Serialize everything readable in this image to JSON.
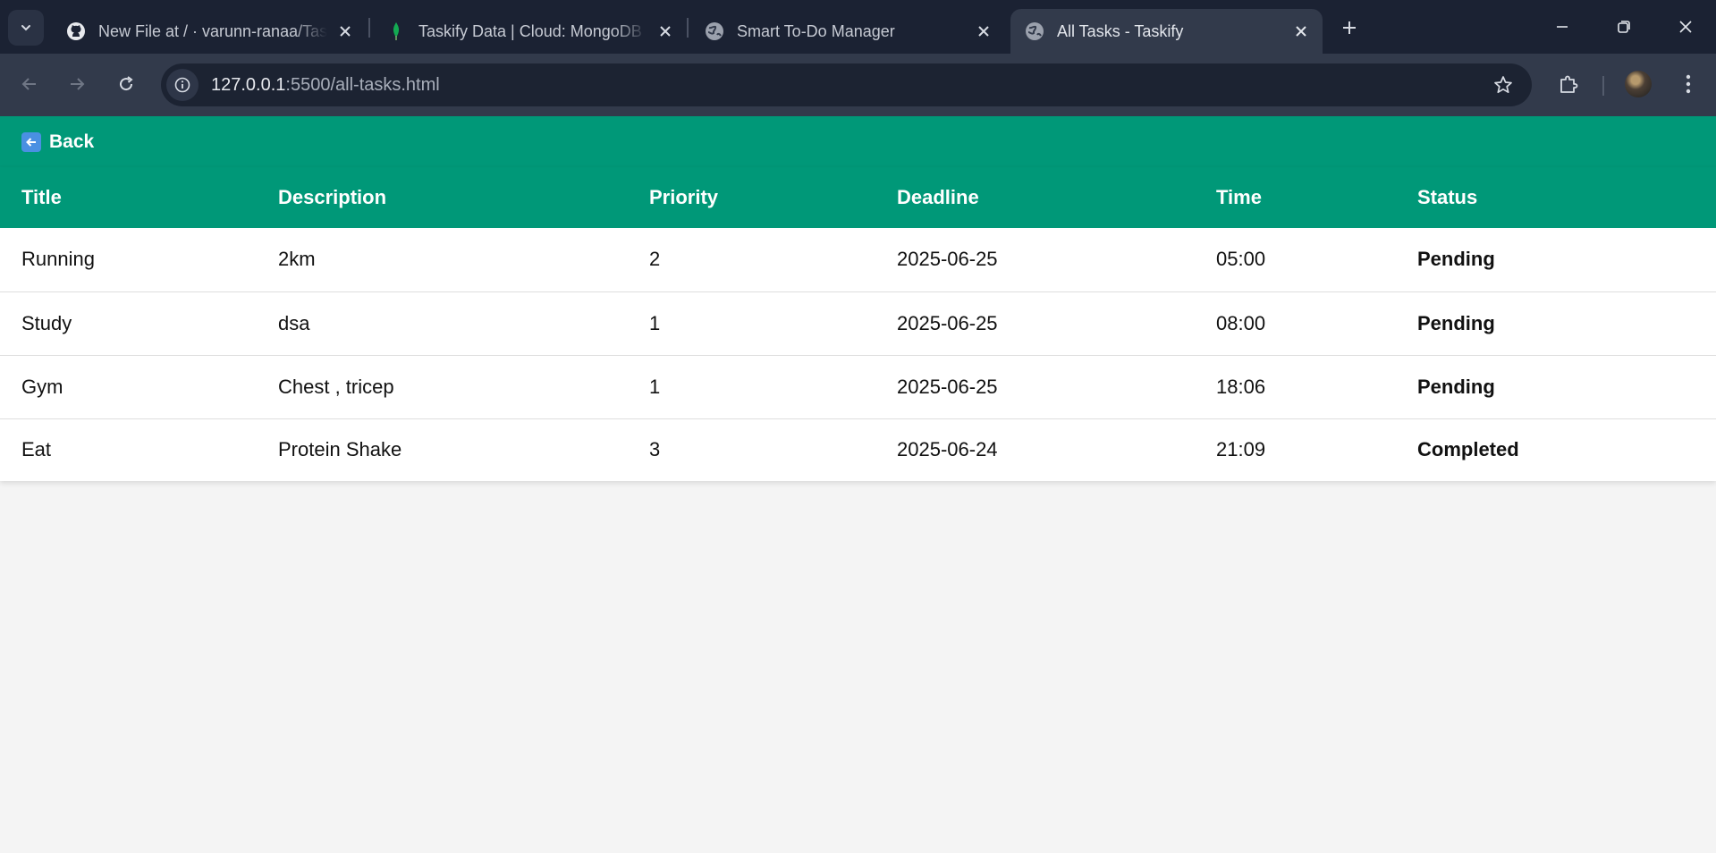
{
  "browser": {
    "tabs": [
      {
        "title": "New File at / · varunn-ranaa/Taskify",
        "icon": "github-icon"
      },
      {
        "title": "Taskify Data | Cloud: MongoDB Cloud",
        "icon": "mongodb-leaf-icon"
      },
      {
        "title": "Smart To-Do Manager",
        "icon": "globe-icon"
      },
      {
        "title": "All Tasks - Taskify",
        "icon": "globe-icon"
      }
    ],
    "url_host": "127.0.0.1",
    "url_path": ":5500/all-tasks.html"
  },
  "page": {
    "back_label": "Back",
    "columns": [
      "Title",
      "Description",
      "Priority",
      "Deadline",
      "Time",
      "Status"
    ],
    "rows": [
      [
        "Running",
        "2km",
        "2",
        "2025-06-25",
        "05:00",
        "Pending"
      ],
      [
        "Study",
        "dsa",
        "1",
        "2025-06-25",
        "08:00",
        "Pending"
      ],
      [
        "Gym",
        "Chest , tricep",
        "1",
        "2025-06-25",
        "18:06",
        "Pending"
      ],
      [
        "Eat",
        "Protein Shake",
        "3",
        "2025-06-24",
        "21:09",
        "Completed"
      ]
    ]
  },
  "colors": {
    "header_green": "#009878",
    "chrome_dark": "#1b2233",
    "toolbar": "#323a4b"
  }
}
